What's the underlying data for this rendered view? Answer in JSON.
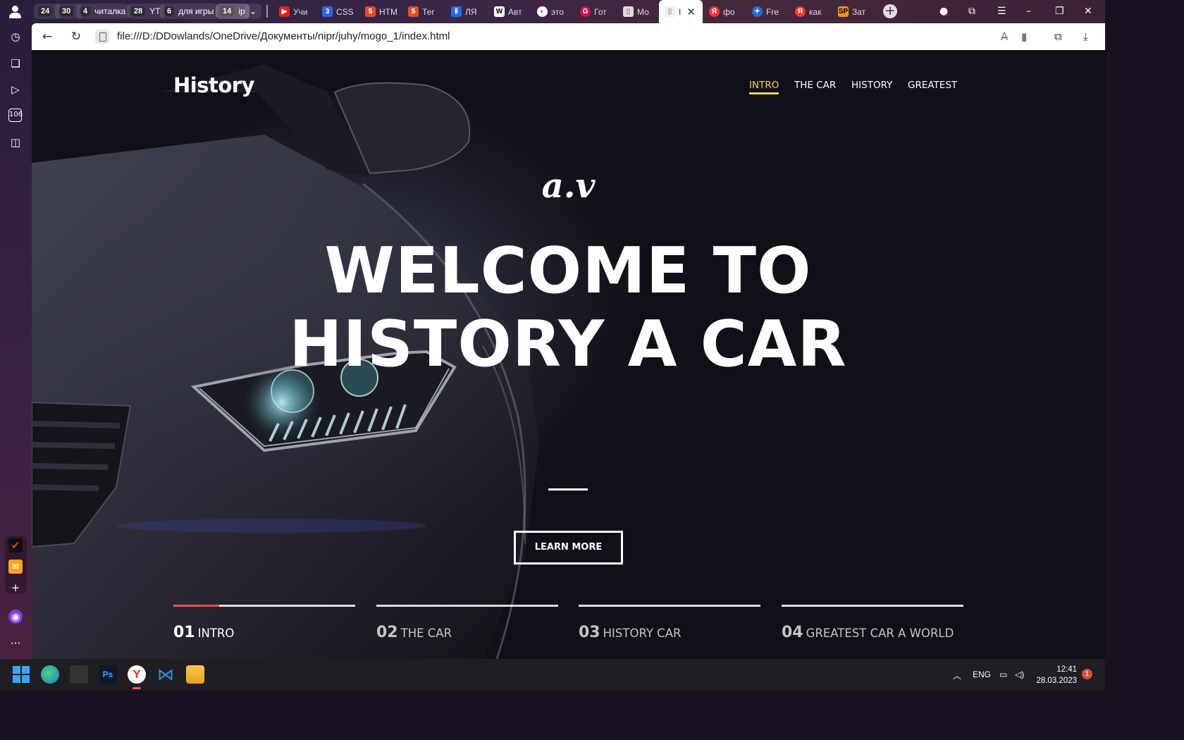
{
  "browser": {
    "tab_groups": [
      {
        "count": "24",
        "label": ""
      },
      {
        "count": "30",
        "label": ""
      },
      {
        "count": "4",
        "label": "читалка"
      },
      {
        "count": "28",
        "label": "YT"
      },
      {
        "count": "6",
        "label": "для игры"
      },
      {
        "count": "14",
        "label": "ip"
      }
    ],
    "tabs": [
      {
        "label": "Учи",
        "favicon": "youtube-icon",
        "color": "#e62117"
      },
      {
        "label": "CSS",
        "favicon": "css-icon",
        "color": "#2965f1"
      },
      {
        "label": "HTM",
        "favicon": "html-icon",
        "color": "#e44d26"
      },
      {
        "label": "Тег",
        "favicon": "html-icon",
        "color": "#e44d26"
      },
      {
        "label": "ЛЯ",
        "favicon": "pause-icon",
        "color": "#1c6ef2"
      },
      {
        "label": "Авт",
        "favicon": "wikipedia-icon",
        "color": "#ffffff"
      },
      {
        "label": "это",
        "favicon": "globe-icon",
        "color": "#2b5fd9"
      },
      {
        "label": "Гот",
        "favicon": "g-icon",
        "color": "#d0114f"
      },
      {
        "label": "Мо",
        "favicon": "file-icon",
        "color": "#dddddd"
      },
      {
        "label": "I",
        "favicon": "file-icon",
        "color": "#dddddd",
        "active": true
      },
      {
        "label": "фо",
        "favicon": "yandex-icon",
        "color": "#f33"
      },
      {
        "label": "Fre",
        "favicon": "star-icon",
        "color": "#2a6bd8"
      },
      {
        "label": "как",
        "favicon": "yandex-icon",
        "color": "#f33"
      },
      {
        "label": "Зат",
        "favicon": "sp-icon",
        "color": "#f7941d"
      }
    ],
    "url": "file:///D:/DDowlands/OneDrive/Документы/nipr/juhy/mogo_1/index.html"
  },
  "sidebar": {
    "items": [
      "history-icon",
      "collections-icon",
      "play-icon",
      "counter-icon",
      "screenshot-icon"
    ],
    "counter_label": "106"
  },
  "site": {
    "logo": "History",
    "nav": [
      {
        "label": "INTRO",
        "active": true
      },
      {
        "label": "THE CAR",
        "active": false
      },
      {
        "label": "HISTORY",
        "active": false
      },
      {
        "label": "GREATEST",
        "active": false
      }
    ],
    "subtitle": "a.v",
    "hero_title": "WELCOME TO HISTORY A CAR",
    "cta_label": "LEARN MORE",
    "slides": [
      {
        "num": "01",
        "label": "INTRO",
        "progress": 0.25
      },
      {
        "num": "02",
        "label": "THE CAR",
        "progress": 0
      },
      {
        "num": "03",
        "label": "HISTORY CAR",
        "progress": 0
      },
      {
        "num": "04",
        "label": "GREATEST CAR A WORLD",
        "progress": 0
      }
    ],
    "accent_color": "#f1d15f",
    "progress_color": "#e2535b"
  },
  "taskbar": {
    "language": "ENG",
    "time": "12:41",
    "date": "28.03.2023",
    "notifications": "1"
  }
}
